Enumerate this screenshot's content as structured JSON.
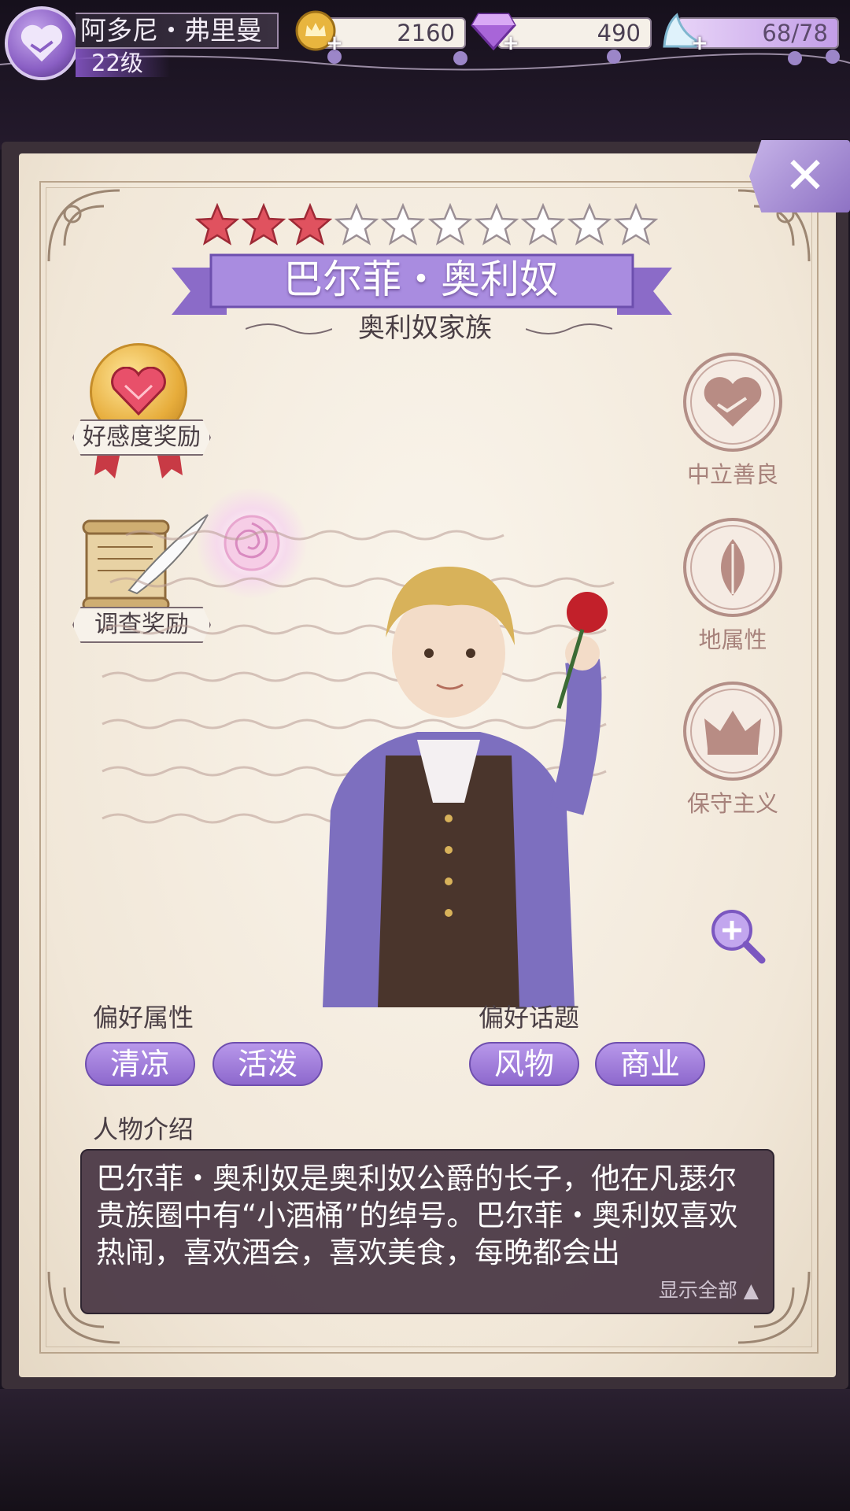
{
  "player": {
    "name": "阿多尼・弗里曼",
    "level": "22级"
  },
  "resources": {
    "gold": "2160",
    "diamond": "490",
    "stamina": "68/78"
  },
  "character": {
    "stars_filled": 3,
    "stars_total": 10,
    "name": "巴尔菲・奥利奴",
    "family": "奥利奴家族"
  },
  "rewards": {
    "affection_label": "好感度奖励",
    "investigation_label": "调查奖励"
  },
  "traits": [
    {
      "label": "中立善良",
      "icon": "handshake-icon"
    },
    {
      "label": "地属性",
      "icon": "leaf-icon"
    },
    {
      "label": "保守主义",
      "icon": "crown-icon"
    }
  ],
  "preferences": {
    "attributes_title": "偏好属性",
    "attributes": [
      "清凉",
      "活泼"
    ],
    "topics_title": "偏好话题",
    "topics": [
      "风物",
      "商业"
    ]
  },
  "intro": {
    "title": "人物介绍",
    "text": "巴尔菲・奥利奴是奥利奴公爵的长子，他在凡瑟尔贵族圈中有“小酒桶”的绰号。巴尔菲・奥利奴喜欢热闹，喜欢酒会，喜欢美食，每晚都会出",
    "show_all": "显示全部 ▲"
  },
  "colors": {
    "accent_purple": "#9b7bd6",
    "star_red": "#e0525f",
    "paper": "#f5eee2"
  }
}
